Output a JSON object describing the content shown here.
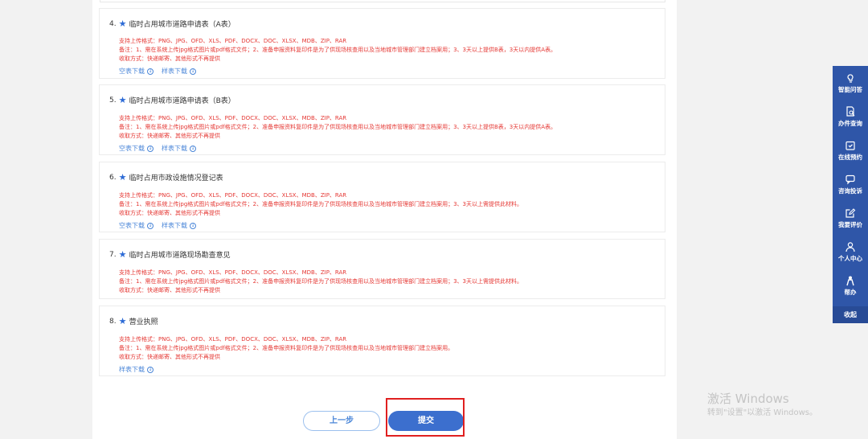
{
  "items": [
    {
      "number": "4.",
      "title": "临时占用城市道路申请表（A表）",
      "formats": "支持上传格式：PNG、JPG、OFD、XLS、PDF、DOCX、DOC、XLSX、MDB、ZIP、RAR",
      "note": "备注：1、需在系统上传jpg格式图片或pdf格式文件；2、准备申报资料复印件是为了供现场核查用以及当地城市管理部门建立档案用；3、3天以上提供B表，3天以内提供A表。",
      "receive": "收取方式：快递邮寄、其他形式不再提供",
      "links": [
        "空表下载",
        "样表下载"
      ]
    },
    {
      "number": "5.",
      "title": "临时占用城市道路申请表（B表）",
      "formats": "支持上传格式：PNG、JPG、OFD、XLS、PDF、DOCX、DOC、XLSX、MDB、ZIP、RAR",
      "note": "备注：1、需在系统上传jpg格式图片或pdf格式文件；2、准备申报资料复印件是为了供现场核查用以及当地城市管理部门建立档案用；3、3天以上提供B表，3天以内提供A表。",
      "receive": "收取方式：快递邮寄、其他形式不再提供",
      "links": [
        "空表下载",
        "样表下载"
      ]
    },
    {
      "number": "6.",
      "title": "临时占用市政设施情况登记表",
      "formats": "支持上传格式：PNG、JPG、OFD、XLS、PDF、DOCX、DOC、XLSX、MDB、ZIP、RAR",
      "note": "备注：1、需在系统上传jpg格式图片或pdf格式文件；2、准备申报资料复印件是为了供现场核查用以及当地城市管理部门建立档案用；3、3天以上需提供此材料。",
      "receive": "收取方式：快递邮寄、其他形式不再提供",
      "links": [
        "空表下载",
        "样表下载"
      ]
    },
    {
      "number": "7.",
      "title": "临时占用城市道路现场勘查意见",
      "formats": "支持上传格式：PNG、JPG、OFD、XLS、PDF、DOCX、DOC、XLSX、MDB、ZIP、RAR",
      "note": "备注：1、需在系统上传jpg格式图片或pdf格式文件；2、准备申报资料复印件是为了供现场核查用以及当地城市管理部门建立档案用；3、3天以上需提供此材料。",
      "receive": "收取方式：快递邮寄、其他形式不再提供",
      "links": []
    },
    {
      "number": "8.",
      "title": "营业执照",
      "formats": "支持上传格式：PNG、JPG、OFD、XLS、PDF、DOCX、DOC、XLSX、MDB、ZIP、RAR",
      "note": "备注：1、需在系统上传jpg格式图片或pdf格式文件；2、准备申报资料复印件是为了供现场核查用以及当地城市管理部门建立档案用。",
      "receive": "收取方式：快递邮寄、其他形式不再提供",
      "links": [
        "样表下载"
      ]
    }
  ],
  "buttons": {
    "prev": "上一步",
    "submit": "提交"
  },
  "sidebar": {
    "items": [
      {
        "label": "智能问答",
        "icon": "smart-qa-icon"
      },
      {
        "label": "办件查询",
        "icon": "document-search-icon"
      },
      {
        "label": "在线预约",
        "icon": "calendar-icon"
      },
      {
        "label": "咨询投诉",
        "icon": "chat-icon"
      },
      {
        "label": "我要评价",
        "icon": "edit-icon"
      },
      {
        "label": "个人中心",
        "icon": "user-icon"
      },
      {
        "label": "帮办",
        "icon": "helper-icon"
      }
    ],
    "collapse": "收起"
  },
  "watermark": {
    "title": "激活 Windows",
    "subtitle": "转到\"设置\"以激活 Windows。"
  },
  "colors": {
    "accent": "#3c6fce",
    "sidebar": "#2f56a8",
    "warning_text": "#e53935",
    "highlight": "#e02020"
  }
}
